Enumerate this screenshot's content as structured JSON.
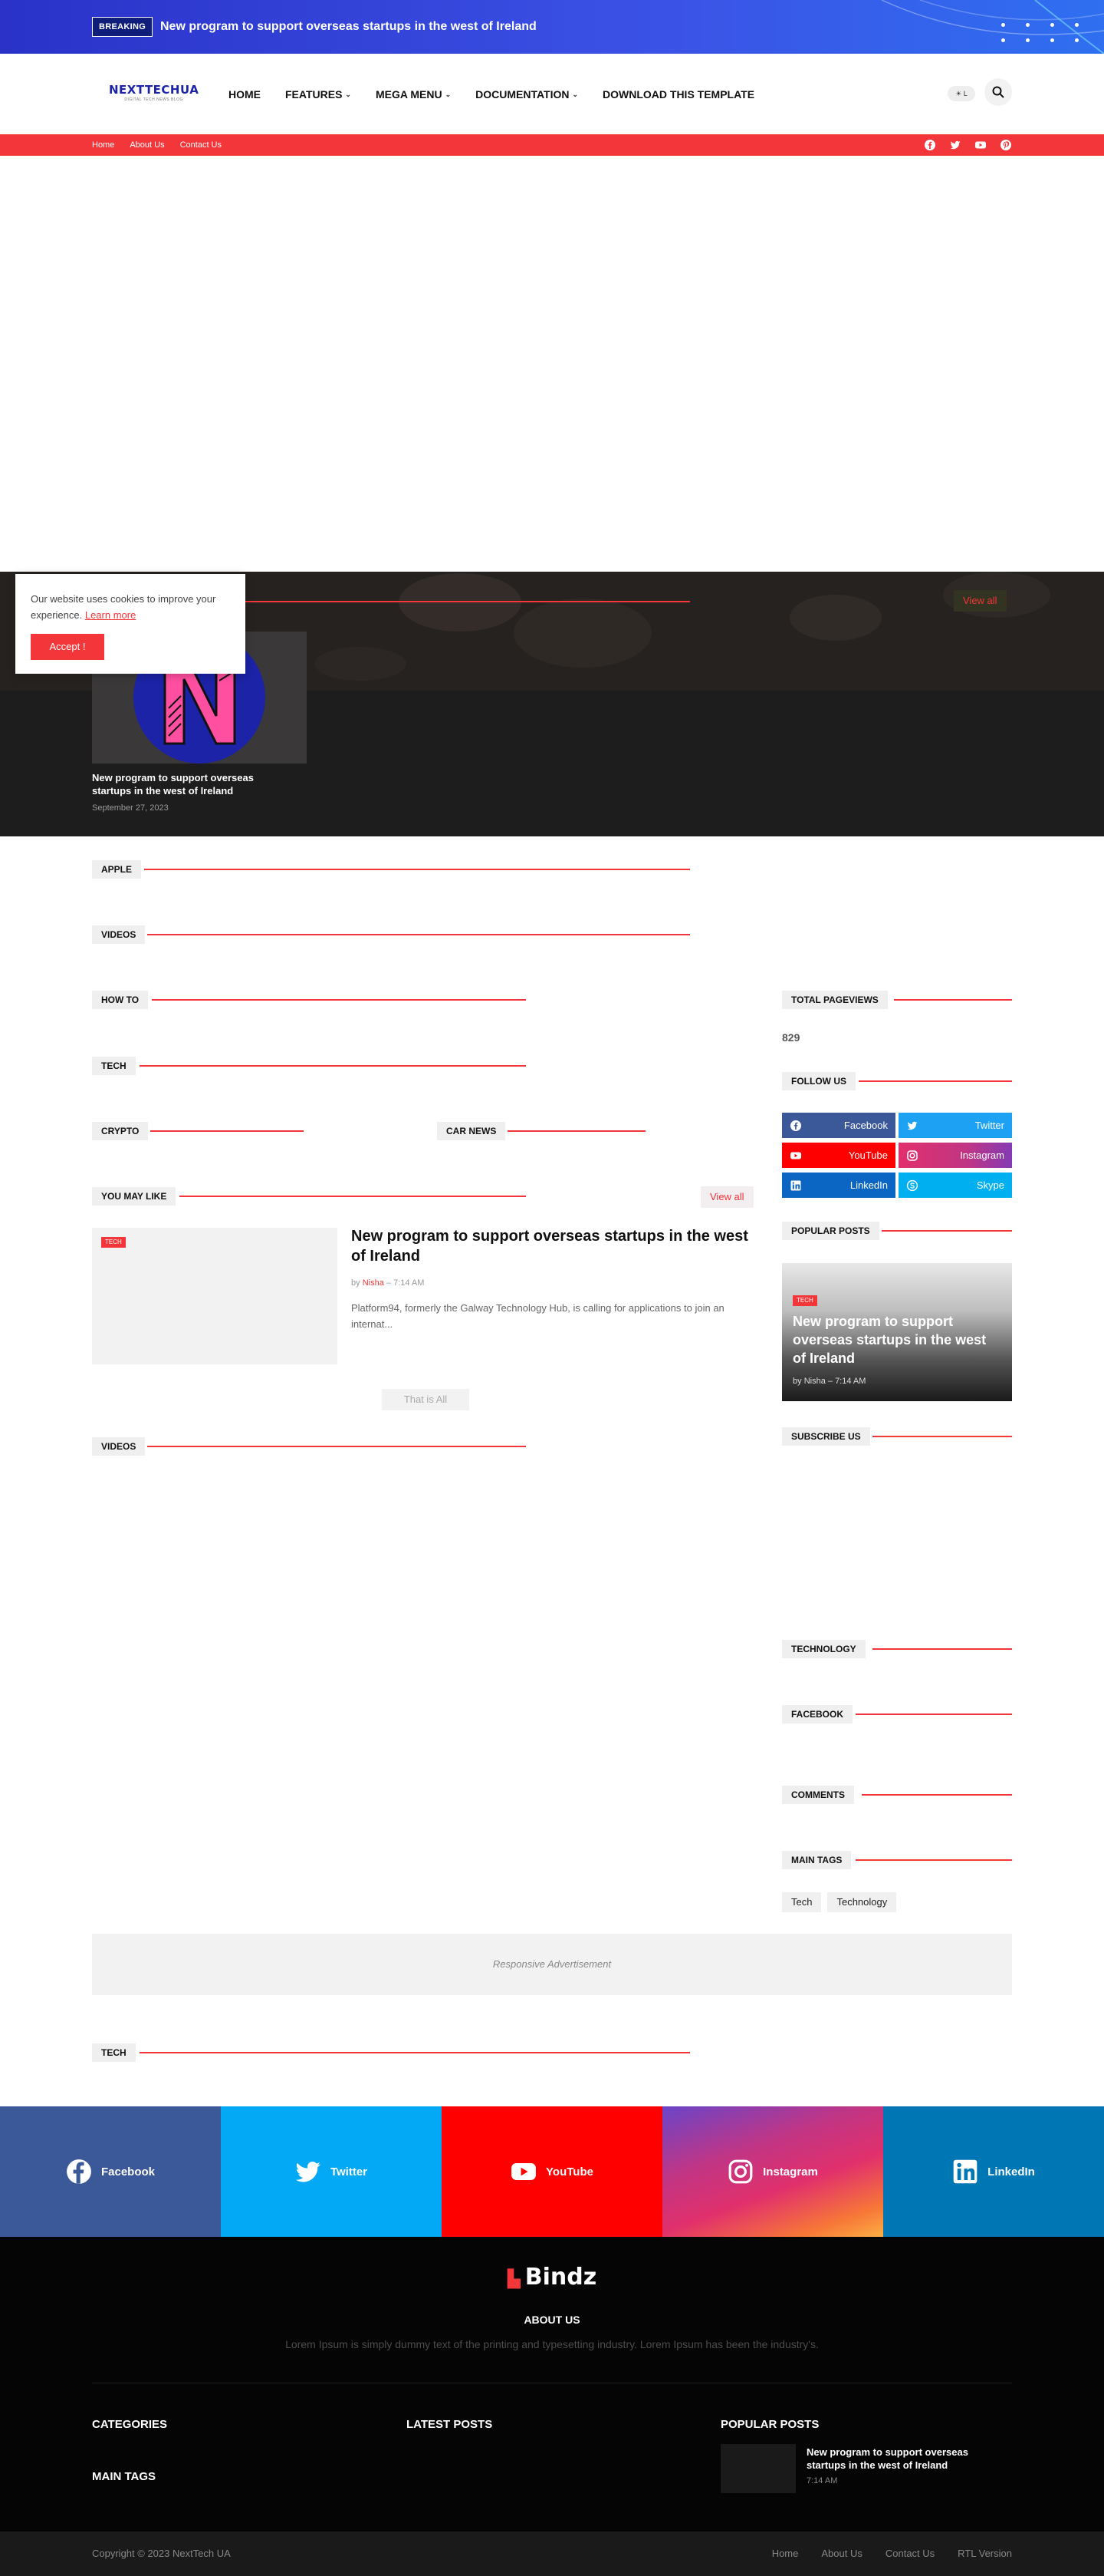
{
  "breaking": {
    "tag": "BREAKING",
    "title": "New program to support overseas startups in the west of Ireland"
  },
  "header": {
    "logo_name": "NEXTTECHUA",
    "logo_tagline": "DIGITAL TECH NEWS BLOG",
    "nav": [
      {
        "label": "HOME",
        "has_dropdown": false
      },
      {
        "label": "FEATURES",
        "has_dropdown": true
      },
      {
        "label": "MEGA MENU",
        "has_dropdown": true
      },
      {
        "label": "DOCUMENTATION",
        "has_dropdown": true
      },
      {
        "label": "DOWNLOAD THIS TEMPLATE",
        "has_dropdown": false
      }
    ],
    "theme_toggle_label": "☀ L"
  },
  "topbar": {
    "links": [
      "Home",
      "About Us",
      "Contact Us"
    ],
    "social_icons": [
      "facebook-icon",
      "twitter-icon",
      "youtube-icon",
      "pinterest-icon"
    ]
  },
  "featured": {
    "view_all": "View all",
    "card_title": "New program to support overseas startups in the west of Ireland",
    "card_date": "September 27, 2023"
  },
  "cookie": {
    "message": "Our website uses cookies to improve your experience.",
    "learn_more": "Learn more",
    "accept": "Accept !"
  },
  "sections": {
    "apple": "APPLE",
    "videos": "VIDEOS",
    "how_to": "HOW TO",
    "tech": "TECH",
    "crypto": "CRYPTO",
    "car_news": "CAR NEWS",
    "you_may_like": "YOU MAY LIKE",
    "videos2": "VIDEOS",
    "tech2": "TECH"
  },
  "you_may_like": {
    "view_all": "View all",
    "post": {
      "tag": "TECH",
      "title": "New program to support overseas startups in the west of Ireland",
      "by": "by",
      "author": "Nisha",
      "sep": "–",
      "time": "7:14 AM",
      "excerpt": "Platform94, formerly the Galway Technology Hub, is calling for applications to join an internat..."
    },
    "end_label": "That is All"
  },
  "sidebar": {
    "total_pageviews_title": "TOTAL PAGEVIEWS",
    "pageviews": "829",
    "follow_us_title": "FOLLOW US",
    "follow_buttons": [
      {
        "label": "Facebook",
        "color": "#3b5998",
        "icon": "facebook-icon"
      },
      {
        "label": "Twitter",
        "color": "#1da1f2",
        "icon": "twitter-icon"
      },
      {
        "label": "YouTube",
        "color": "#ff0000",
        "icon": "youtube-icon"
      },
      {
        "label": "Instagram",
        "color": "#c13584",
        "icon": "instagram-icon"
      },
      {
        "label": "LinkedIn",
        "color": "#0a66c2",
        "icon": "linkedin-icon"
      },
      {
        "label": "Skype",
        "color": "#00aff0",
        "icon": "skype-icon"
      }
    ],
    "popular_posts_title": "POPULAR POSTS",
    "popular_post": {
      "tag": "TECH",
      "title": "New program to support overseas startups in the west of Ireland",
      "by": "by",
      "author": "Nisha",
      "sep": "–",
      "time": "7:14 AM"
    },
    "subscribe_title": "SUBSCRIBE US",
    "technology_title": "TECHNOLOGY",
    "facebook_title": "FACEBOOK",
    "comments_title": "COMMENTS",
    "main_tags_title": "MAIN TAGS",
    "tags": [
      "Tech",
      "Technology"
    ]
  },
  "ad": {
    "label": "Responsive Advertisement"
  },
  "social_strip": [
    {
      "label": "Facebook",
      "color": "#3b5998",
      "icon": "facebook-icon"
    },
    {
      "label": "Twitter",
      "color": "#03a9f4",
      "icon": "twitter-icon"
    },
    {
      "label": "YouTube",
      "color": "#ff0000",
      "icon": "youtube-icon"
    },
    {
      "label": "Instagram",
      "color": "#e1306c",
      "icon": "instagram-icon"
    },
    {
      "label": "LinkedIn",
      "color": "#0077b5",
      "icon": "linkedin-icon"
    }
  ],
  "footer": {
    "logo_text": "Bindz",
    "about_title": "ABOUT US",
    "about_text": "Lorem Ipsum is simply dummy text of the printing and typesetting industry. Lorem Ipsum has been the industry's.",
    "categories_title": "CATEGORIES",
    "main_tags_title": "MAIN TAGS",
    "latest_posts_title": "LATEST POSTS",
    "popular_posts_title": "POPULAR POSTS",
    "popular_post_title": "New program to support overseas startups in the west of Ireland",
    "popular_post_time": "7:14 AM",
    "copyright": "Copyright © 2023 NextTech UA",
    "bottom_links": [
      "Home",
      "About Us",
      "Contact Us",
      "RTL Version"
    ]
  },
  "colors": {
    "accent": "#f2363a",
    "breaking_bg": "#3b52e6",
    "footer_bg": "#050505"
  }
}
